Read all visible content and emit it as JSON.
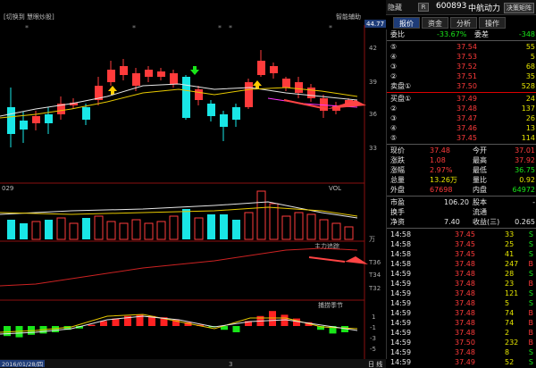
{
  "header": {
    "left_label": "[切换到 慧眼炒股]",
    "indicator_label": "智能辅助",
    "price_tag": "44.77"
  },
  "topbar": {
    "mode": "隐藏",
    "badge": "R",
    "code": "600893",
    "name": "中航动力",
    "button": "决策矩阵"
  },
  "tabs": [
    "报价",
    "资金",
    "分析",
    "操作"
  ],
  "axes": {
    "price_ticks": [
      "42",
      "39",
      "36",
      "33"
    ],
    "vol_unit": "万",
    "vol_ticks": [],
    "flow_ticks": [
      "T36",
      "T34",
      "T32"
    ],
    "cycle_ticks": [
      "1",
      "-1",
      "-3",
      "-5"
    ]
  },
  "panels": {
    "vol_label": "VOL",
    "vol_left": "029",
    "flow_label": "主力追踪",
    "cycle_label": "捕捞季节"
  },
  "footer": {
    "date": "2016/01/28/四",
    "mid": "3",
    "right": "日 线"
  },
  "order_book": {
    "ratio_label": "委比",
    "ratio_value": "-33.67%",
    "diff_label": "委差",
    "diff_value": "-348",
    "asks": [
      {
        "level": "⑤",
        "price": "37.54",
        "vol": "55"
      },
      {
        "level": "④",
        "price": "37.53",
        "vol": "5"
      },
      {
        "level": "③",
        "price": "37.52",
        "vol": "68"
      },
      {
        "level": "②",
        "price": "37.51",
        "vol": "35"
      },
      {
        "level": "卖盘①",
        "price": "37.50",
        "vol": "528"
      }
    ],
    "bids": [
      {
        "level": "买盘①",
        "price": "37.49",
        "vol": "24"
      },
      {
        "level": "②",
        "price": "37.48",
        "vol": "137"
      },
      {
        "level": "③",
        "price": "37.47",
        "vol": "26"
      },
      {
        "level": "④",
        "price": "37.46",
        "vol": "13"
      },
      {
        "level": "⑤",
        "price": "37.45",
        "vol": "114"
      }
    ]
  },
  "stats": [
    {
      "l1": "现价",
      "v1": "37.48",
      "l2": "今开",
      "v2": "37.01"
    },
    {
      "l1": "涨跌",
      "v1": "1.08",
      "l2": "最高",
      "v2": "37.92"
    },
    {
      "l1": "涨幅",
      "v1": "2.97%",
      "l2": "最低",
      "v2": "36.75"
    },
    {
      "l1": "总量",
      "v1": "13.26万",
      "l2": "量比",
      "v2": "0.92"
    },
    {
      "l1": "外盘",
      "v1": "67698",
      "l2": "内盘",
      "v2": "64972"
    }
  ],
  "info": [
    {
      "l1": "市盈",
      "v1": "106.20",
      "l2": "股本",
      "v2": "-"
    },
    {
      "l1": "换手",
      "v1": "",
      "l2": "流通",
      "v2": ""
    },
    {
      "l1": "净资",
      "v1": "7.40",
      "l2": "收益(三)",
      "v2": "0.265"
    }
  ],
  "ticks": [
    {
      "t": "14:58",
      "p": "37.45",
      "v": "33",
      "s": "S"
    },
    {
      "t": "14:58",
      "p": "37.45",
      "v": "25",
      "s": "S"
    },
    {
      "t": "14:58",
      "p": "37.45",
      "v": "41",
      "s": "S"
    },
    {
      "t": "14:58",
      "p": "37.48",
      "v": "247",
      "s": "B"
    },
    {
      "t": "14:59",
      "p": "37.48",
      "v": "28",
      "s": "S"
    },
    {
      "t": "14:59",
      "p": "37.48",
      "v": "23",
      "s": "B"
    },
    {
      "t": "14:59",
      "p": "37.48",
      "v": "121",
      "s": "S"
    },
    {
      "t": "14:59",
      "p": "37.48",
      "v": "5",
      "s": "S"
    },
    {
      "t": "14:59",
      "p": "37.48",
      "v": "74",
      "s": "B"
    },
    {
      "t": "14:59",
      "p": "37.48",
      "v": "74",
      "s": "B"
    },
    {
      "t": "14:59",
      "p": "37.48",
      "v": "2",
      "s": "B"
    },
    {
      "t": "14:59",
      "p": "37.50",
      "v": "232",
      "s": "B"
    },
    {
      "t": "14:59",
      "p": "37.48",
      "v": "8",
      "s": "S"
    },
    {
      "t": "14:59",
      "p": "37.49",
      "v": "52",
      "s": "S"
    }
  ],
  "colors": {
    "up": "#ff3b3b",
    "down": "#19e6e6",
    "bg": "#000000",
    "ma1": "#e6e6e6",
    "ma2": "#e6c800",
    "ma3": "#ff33ff"
  }
}
